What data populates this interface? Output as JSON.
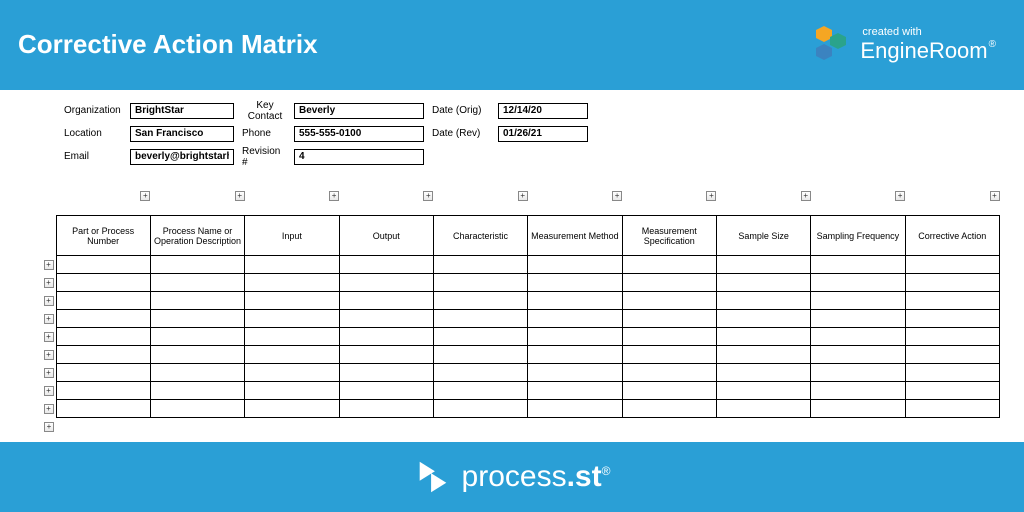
{
  "header": {
    "title": "Corrective Action Matrix",
    "created_with": "created with",
    "brand_name_1": "Engine",
    "brand_name_2": "Room"
  },
  "form": {
    "organization_label": "Organization",
    "organization_value": "BrightStar",
    "keycontact_label": "Key Contact",
    "keycontact_value": "Beverly",
    "dateorig_label": "Date (Orig)",
    "dateorig_value": "12/14/20",
    "location_label": "Location",
    "location_value": "San Francisco",
    "phone_label": "Phone",
    "phone_value": "555-555-0100",
    "daterev_label": "Date (Rev)",
    "daterev_value": "01/26/21",
    "email_label": "Email",
    "email_value": "beverly@brightstarhq.com",
    "revision_label": "Revision #",
    "revision_value": "4"
  },
  "matrix": {
    "columns": [
      "Part or Process Number",
      "Process Name or Operation Description",
      "Input",
      "Output",
      "Characteristic",
      "Measurement Method",
      "Measurement Specification",
      "Sample Size",
      "Sampling Frequency",
      "Corrective Action"
    ],
    "row_count": 9,
    "plus_glyph": "+"
  },
  "footer": {
    "brand_1": "process",
    "brand_2": ".st"
  }
}
